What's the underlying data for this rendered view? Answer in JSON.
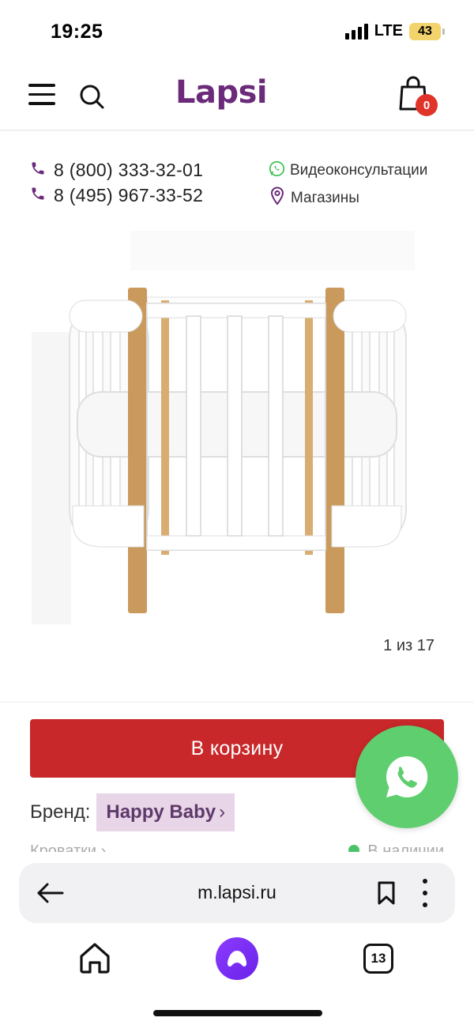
{
  "status_bar": {
    "time": "19:25",
    "network": "LTE",
    "battery": "43"
  },
  "header": {
    "logo": "Lapsi",
    "cart_count": "0",
    "icons": [
      "menu-icon",
      "search-icon",
      "shopping-bag-icon"
    ]
  },
  "contacts": {
    "phone_1": "8 (800) 333-32-01",
    "phone_2": "8 (495) 967-33-52",
    "video_consult": "Видеоконсультации",
    "stores": "Магазины",
    "icons": [
      "phone-icon",
      "whatsapp-icon",
      "map-pin-icon"
    ]
  },
  "gallery": {
    "counter": "1 из 17"
  },
  "product": {
    "add_to_cart": "В корзину",
    "brand_label": "Бренд:",
    "brand_value": "Happy Baby",
    "brand_chevron": "›",
    "category": "Кроватки ›",
    "availability": "В наличии"
  },
  "browser": {
    "url": "m.lapsi.ru",
    "tabs_count": "13",
    "icons": [
      "back-arrow-icon",
      "bookmark-icon",
      "more-vertical-icon",
      "home-icon",
      "alice-icon",
      "tabs-icon"
    ]
  },
  "colors": {
    "brand_purple": "#6b2a7a",
    "cart_red": "#c9282a",
    "whatsapp_green": "#5fce6f",
    "badge_red": "#e0332a",
    "brand_chip": "#e8d5e8"
  }
}
